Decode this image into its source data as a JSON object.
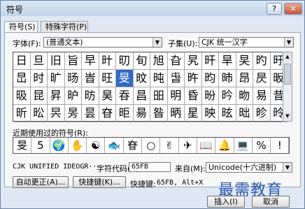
{
  "window": {
    "title": "符号",
    "help_label": "?",
    "close_label": "✕"
  },
  "tabs": [
    {
      "label": "符号(S)",
      "active": true
    },
    {
      "label": "特殊字符(P)",
      "active": false
    }
  ],
  "font": {
    "label": "字体(F):",
    "value": "(普通文本)"
  },
  "subset": {
    "label": "子集(U):",
    "value": "CJK 统一汉字"
  },
  "grid": {
    "rows": [
      [
        "日",
        "旦",
        "旧",
        "旨",
        "早",
        "旪",
        "旫",
        "旬",
        "旭",
        "旮",
        "旯",
        "旰",
        "旱",
        "旲",
        "旳",
        "旴"
      ],
      [
        "旵",
        "时",
        "旷",
        "旸",
        "旹",
        "旺",
        "旻",
        "旼",
        "旽",
        "旾",
        "旿",
        "昀",
        "昁",
        "昂",
        "昃",
        "昄"
      ],
      [
        "昅",
        "昆",
        "昇",
        "昈",
        "昉",
        "昊",
        "昋",
        "昌",
        "昍",
        "明",
        "昏",
        "昐",
        "昑",
        "昒",
        "易",
        "昔"
      ],
      [
        "昕",
        "昖",
        "昗",
        "昘",
        "昙",
        "昚",
        "昛",
        "昜",
        "昝",
        "昞",
        "星",
        "映",
        "昡",
        "昢",
        "昣",
        "昤"
      ]
    ],
    "selected": {
      "row": 1,
      "col": 6
    }
  },
  "recent": {
    "label": "近期使用过的符号(R):",
    "symbols": [
      "旻",
      "5",
      "🌍",
      "✋",
      "☯",
      "🐟",
      "眘",
      "○",
      "✌",
      "✈",
      "📖",
      "🔔",
      "💻",
      "%",
      "!"
    ]
  },
  "char_name": "CJK UNIFIED IDEOGR···",
  "char_code": {
    "label": "字符代码(C):",
    "value": "65FB"
  },
  "from": {
    "label": "来自(M):",
    "value": "Unicode(十六进制)"
  },
  "buttons": {
    "autocorrect": "自动更正(A)...",
    "shortcut_key": "快捷键(K)...",
    "insert": "插入(I)",
    "cancel": "取消"
  },
  "shortcut": {
    "label": "快捷键:",
    "value": "65FB, Alt+X"
  },
  "watermark": "最需教育"
}
